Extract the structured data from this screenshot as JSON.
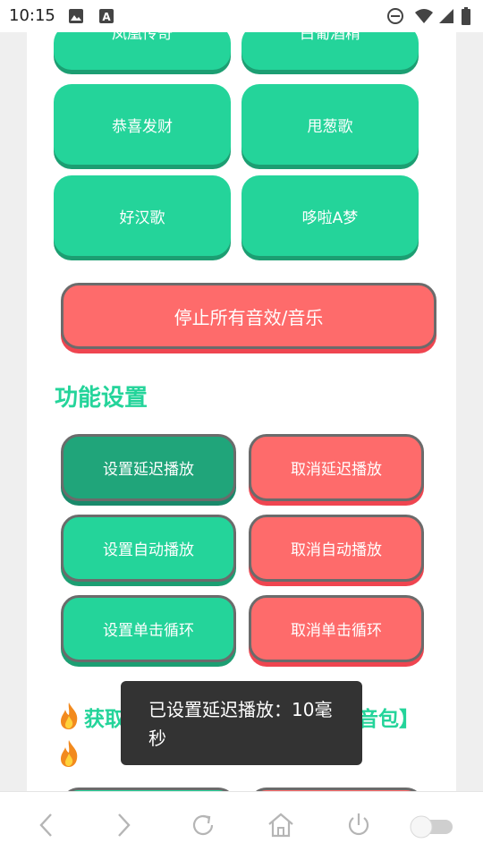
{
  "status_bar": {
    "time": "10:15",
    "icons": [
      "image-icon",
      "font-download-icon",
      "do-not-disturb-icon",
      "wifi-icon",
      "signal-icon",
      "battery-icon"
    ]
  },
  "sound_buttons": [
    {
      "label": "凤凰传奇"
    },
    {
      "label": "白葡酒精"
    },
    {
      "label": "恭喜发财"
    },
    {
      "label": "甩葱歌"
    },
    {
      "label": "好汉歌"
    },
    {
      "label": "哆啦A梦"
    }
  ],
  "stop_all": {
    "label": "停止所有音效/音乐"
  },
  "settings": {
    "title": "功能设置",
    "set_delay": "设置延迟播放",
    "cancel_delay": "取消延迟播放",
    "set_autoplay": "设置自动播放",
    "cancel_autoplay": "取消自动播放",
    "set_loop": "设置单击循环",
    "cancel_loop": "取消单击循环"
  },
  "promo": {
    "prefix": "获取",
    "suffix": "音包】"
  },
  "toast": {
    "message": "已设置延迟播放：10毫秒"
  },
  "nav": [
    "back-icon",
    "forward-icon",
    "reload-icon",
    "home-icon",
    "power-icon",
    "toggle-switch"
  ],
  "colors": {
    "accent_green": "#24d49a",
    "active_green": "#20a57a",
    "accent_red": "#fe6b6b",
    "toast_bg": "#333333"
  }
}
